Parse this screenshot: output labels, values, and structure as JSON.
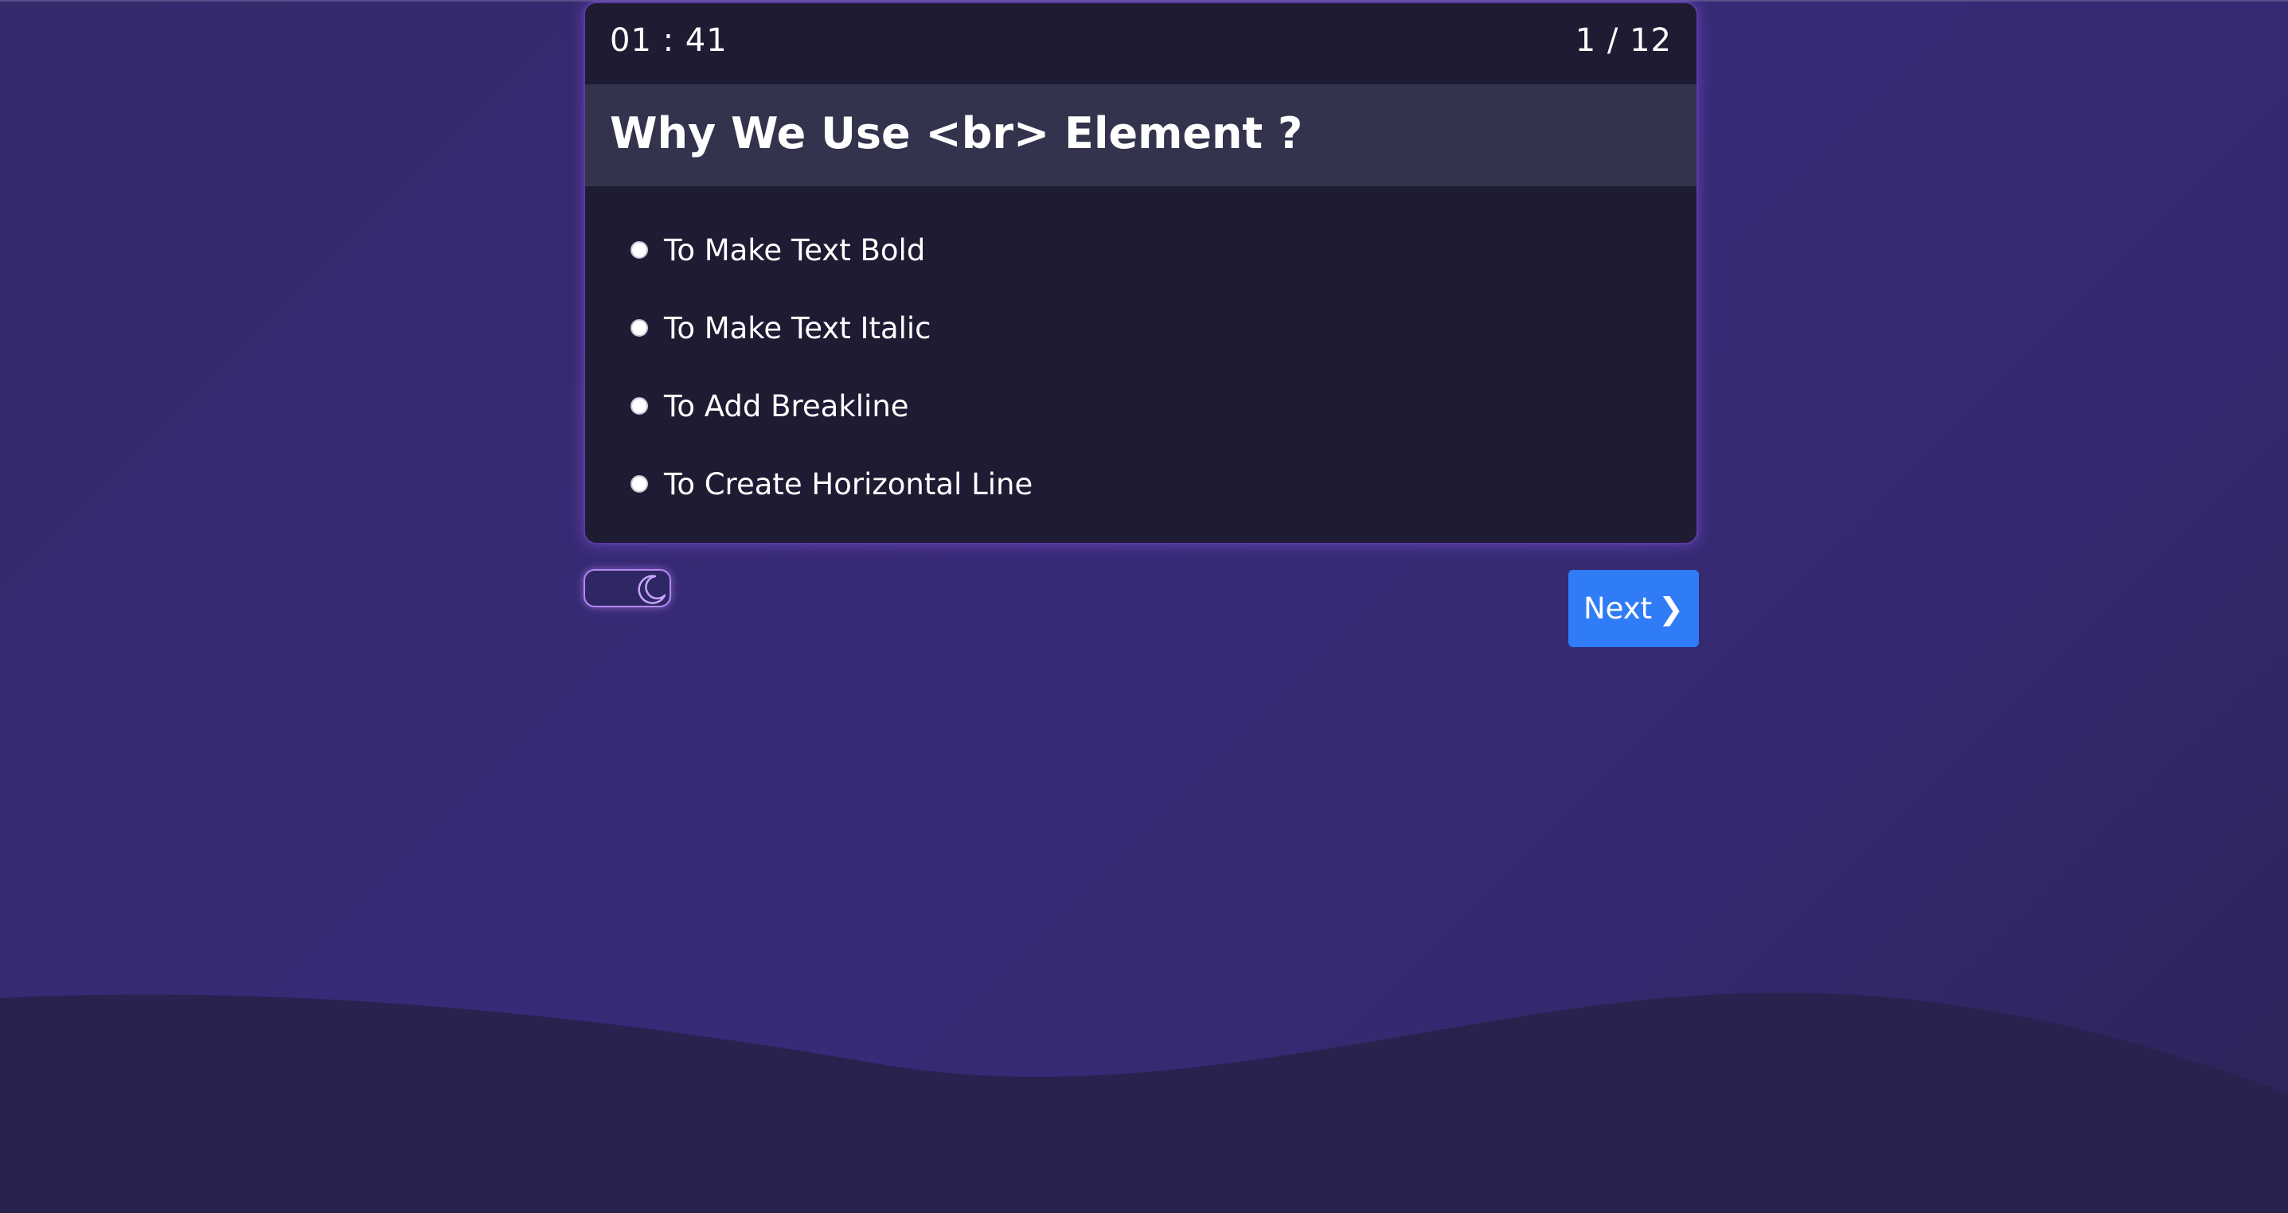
{
  "quiz": {
    "timer": "01 : 41",
    "progress": "1 / 12",
    "question": "Why We Use <br> Element ?",
    "options": [
      "To Make Text Bold",
      "To Make Text Italic",
      "To Add Breakline",
      "To Create Horizontal Line"
    ]
  },
  "controls": {
    "theme_toggle_icon": "moon-icon",
    "next_label": "Next",
    "next_icon": "chevron-right-icon"
  },
  "colors": {
    "background": "#382a78",
    "wave": "#28224f",
    "card": "#1e1c33",
    "question_bar": "#33334d",
    "accent_border": "#5b3aa8",
    "next_button": "#2f7cf6"
  }
}
